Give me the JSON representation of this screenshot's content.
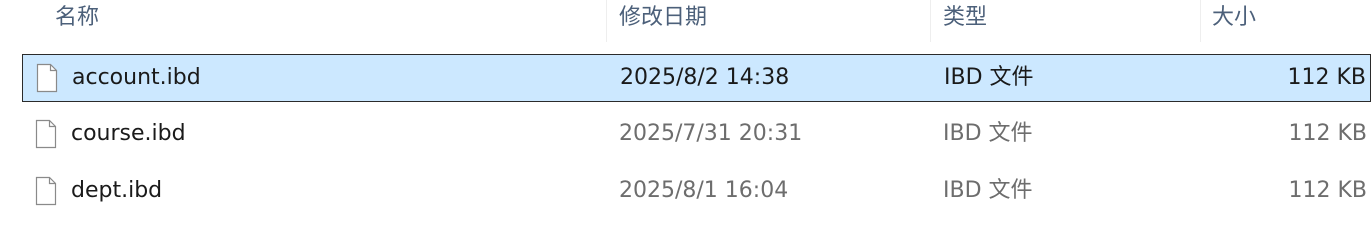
{
  "columns": {
    "name": "名称",
    "modified": "修改日期",
    "type": "类型",
    "size": "大小"
  },
  "files": [
    {
      "name": "account.ibd",
      "modified": "2025/8/2 14:38",
      "type": "IBD 文件",
      "size": "112 KB",
      "selected": true
    },
    {
      "name": "course.ibd",
      "modified": "2025/7/31 20:31",
      "type": "IBD 文件",
      "size": "112 KB",
      "selected": false
    },
    {
      "name": "dept.ibd",
      "modified": "2025/8/1 16:04",
      "type": "IBD 文件",
      "size": "112 KB",
      "selected": false
    }
  ],
  "colors": {
    "selection_bg": "#cce8ff",
    "header_text": "#4c607a",
    "secondary_text": "#6d6d6d"
  },
  "icons": {
    "file": "file-icon"
  }
}
